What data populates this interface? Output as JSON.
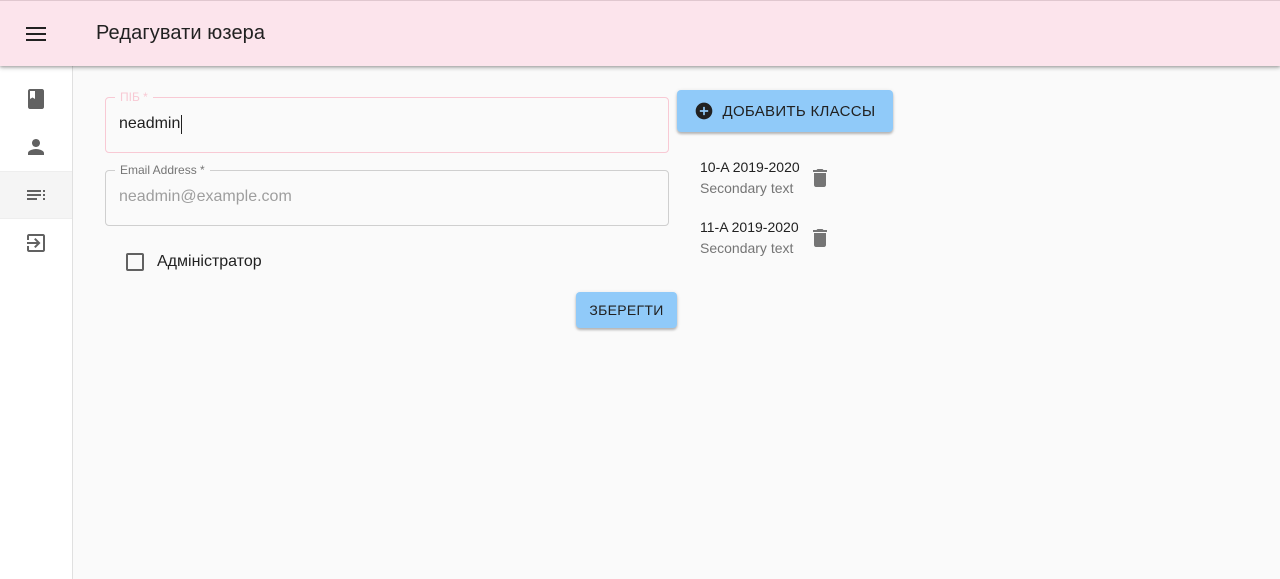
{
  "appbar": {
    "title": "Редагувати юзера"
  },
  "drawer": {
    "items": [
      "book-icon",
      "person-icon",
      "list-icon",
      "login-icon"
    ],
    "active_index": 2
  },
  "form": {
    "name": {
      "label": "ПІБ *",
      "value": "neadmin"
    },
    "email": {
      "label": "Email Address *",
      "value": "",
      "placeholder": "neadmin@example.com"
    },
    "admin_checkbox": {
      "label": "Адміністратор",
      "checked": false
    },
    "save_label": "Зберегти"
  },
  "classes": {
    "add_label": "Добавить классы",
    "items": [
      {
        "primary": "10-A 2019-2020",
        "secondary": "Secondary text"
      },
      {
        "primary": "11-A 2019-2020",
        "secondary": "Secondary text"
      }
    ]
  },
  "colors": {
    "appbar": "#fce4ec",
    "button": "#90caf9",
    "focus_outline": "#f8c9d4"
  }
}
